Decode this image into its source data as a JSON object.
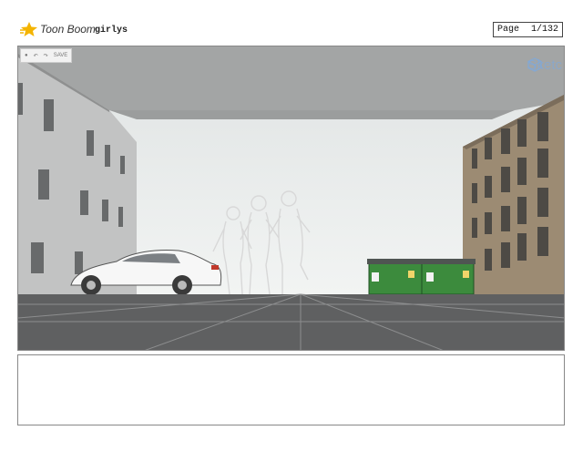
{
  "header": {
    "brand": "Toon Boom",
    "project_name": "girlys",
    "page_label": "Page",
    "page_number": "1/132"
  },
  "panel_toolbar": {
    "user_icon": "person-icon",
    "undo_icon": "undo-icon",
    "redo_icon": "redo-icon",
    "save_label": "SAVE"
  },
  "watermark": {
    "text": "Sketc"
  },
  "notes": {
    "text": ""
  }
}
